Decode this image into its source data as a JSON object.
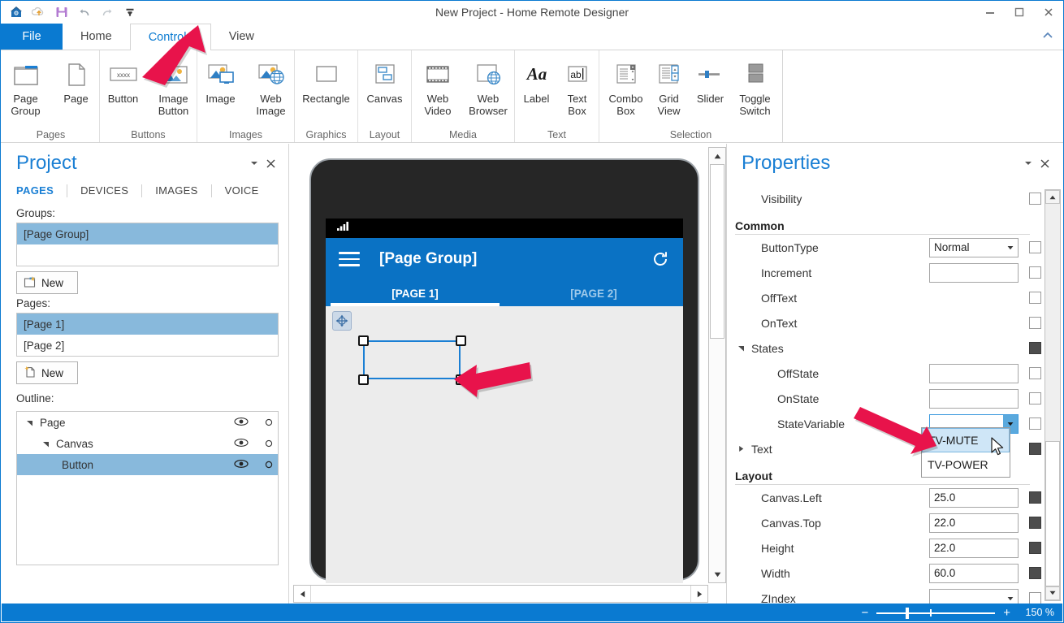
{
  "window": {
    "title": "New Project - Home Remote Designer",
    "quick_access": [
      "home-icon",
      "save-cloud-icon",
      "save-icon",
      "undo-icon",
      "redo-icon",
      "customize-qat-icon"
    ],
    "controls": {
      "minimize": "minimize-icon",
      "maximize": "maximize-icon",
      "close": "close-icon"
    }
  },
  "ribbon": {
    "tabs": [
      {
        "label": "File",
        "kind": "file"
      },
      {
        "label": "Home",
        "kind": "normal"
      },
      {
        "label": "Controls",
        "kind": "active"
      },
      {
        "label": "View",
        "kind": "normal"
      }
    ],
    "collapse_icon": "chevron-up-icon",
    "groups": [
      {
        "label": "Pages",
        "items": [
          {
            "label": "Page\nGroup",
            "icon": "page-group-icon"
          },
          {
            "label": "Page",
            "icon": "page-icon"
          }
        ]
      },
      {
        "label": "Buttons",
        "items": [
          {
            "label": "Button",
            "icon": "button-icon"
          },
          {
            "label": "Image\nButton",
            "icon": "image-button-icon"
          }
        ]
      },
      {
        "label": "Images",
        "items": [
          {
            "label": "Image",
            "icon": "image-icon"
          },
          {
            "label": "Web\nImage",
            "icon": "web-image-icon"
          }
        ]
      },
      {
        "label": "Graphics",
        "items": [
          {
            "label": "Rectangle",
            "icon": "rectangle-icon"
          }
        ]
      },
      {
        "label": "Layout",
        "items": [
          {
            "label": "Canvas",
            "icon": "canvas-icon"
          }
        ]
      },
      {
        "label": "Media",
        "items": [
          {
            "label": "Web\nVideo",
            "icon": "web-video-icon"
          },
          {
            "label": "Web\nBrowser",
            "icon": "web-browser-icon"
          }
        ]
      },
      {
        "label": "Text",
        "items": [
          {
            "label": "Label",
            "icon": "label-icon"
          },
          {
            "label": "Text\nBox",
            "icon": "text-box-icon"
          }
        ]
      },
      {
        "label": "Selection",
        "items": [
          {
            "label": "Combo\nBox",
            "icon": "combo-box-icon"
          },
          {
            "label": "Grid\nView",
            "icon": "grid-view-icon"
          },
          {
            "label": "Slider",
            "icon": "slider-icon"
          },
          {
            "label": "Toggle\nSwitch",
            "icon": "toggle-switch-icon"
          }
        ]
      }
    ]
  },
  "project_panel": {
    "title": "Project",
    "collapse_icon": "chevron-down-icon",
    "close_icon": "close-icon",
    "tabs": [
      {
        "label": "PAGES",
        "active": true
      },
      {
        "label": "DEVICES",
        "active": false
      },
      {
        "label": "IMAGES",
        "active": false
      },
      {
        "label": "VOICE",
        "active": false
      }
    ],
    "groups_label": "Groups:",
    "groups": [
      {
        "label": "[Page Group]",
        "selected": true
      },
      {
        "label": "",
        "selected": false
      }
    ],
    "groups_new_button": "New",
    "pages_label": "Pages:",
    "pages": [
      {
        "label": "[Page 1]",
        "selected": true
      },
      {
        "label": "[Page 2]",
        "selected": false
      }
    ],
    "pages_new_button": "New",
    "outline_label": "Outline:",
    "outline": [
      {
        "label": "Page",
        "depth": 0,
        "expanded": true,
        "selected": false,
        "visible_icon": "eye-icon",
        "lock_icon": "circle-icon"
      },
      {
        "label": "Canvas",
        "depth": 1,
        "expanded": true,
        "selected": false,
        "visible_icon": "eye-icon",
        "lock_icon": "circle-icon"
      },
      {
        "label": "Button",
        "depth": 2,
        "expanded": false,
        "selected": true,
        "visible_icon": "eye-icon",
        "lock_icon": "circle-icon"
      }
    ]
  },
  "designer": {
    "device_status_icon": "signal-bars-icon",
    "app_title": "[Page Group]",
    "menu_icon": "hamburger-icon",
    "refresh_icon": "refresh-icon",
    "tabs": [
      {
        "label": "[PAGE 1]",
        "active": true
      },
      {
        "label": "[PAGE 2]",
        "active": false
      }
    ],
    "move_handle_icon": "move-handle-icon",
    "h_scroll_left_icon": "triangle-left-icon",
    "h_scroll_right_icon": "triangle-right-icon",
    "v_scroll_up_icon": "triangle-up-icon",
    "v_scroll_down_icon": "triangle-down-icon"
  },
  "properties": {
    "title": "Properties",
    "collapse_icon": "chevron-down-icon",
    "close_icon": "close-icon",
    "rows": [
      {
        "type": "prop",
        "name": "Visibility",
        "indent": 1,
        "field": null,
        "check": "empty"
      },
      {
        "type": "section",
        "name": "Common"
      },
      {
        "type": "prop",
        "name": "ButtonType",
        "indent": 1,
        "field": {
          "kind": "combo",
          "value": "Normal"
        },
        "check": "empty"
      },
      {
        "type": "prop",
        "name": "Increment",
        "indent": 1,
        "field": {
          "kind": "text",
          "value": ""
        },
        "check": "empty"
      },
      {
        "type": "prop",
        "name": "OffText",
        "indent": 1,
        "field": null,
        "check": "empty"
      },
      {
        "type": "prop",
        "name": "OnText",
        "indent": 1,
        "field": null,
        "check": "empty"
      },
      {
        "type": "prop",
        "name": "States",
        "indent": 1,
        "expander": "down",
        "field": null,
        "check": "filled"
      },
      {
        "type": "prop",
        "name": "OffState",
        "indent": 2,
        "field": {
          "kind": "text",
          "value": ""
        },
        "check": "empty"
      },
      {
        "type": "prop",
        "name": "OnState",
        "indent": 2,
        "field": {
          "kind": "text",
          "value": ""
        },
        "check": "empty"
      },
      {
        "type": "prop",
        "name": "StateVariable",
        "indent": 2,
        "field": {
          "kind": "combo-open",
          "value": ""
        },
        "check": "empty"
      },
      {
        "type": "prop",
        "name": "Text",
        "indent": 1,
        "expander": "right",
        "field": null,
        "check": "filled"
      },
      {
        "type": "section",
        "name": "Layout"
      },
      {
        "type": "prop",
        "name": "Canvas.Left",
        "indent": 1,
        "field": {
          "kind": "text",
          "value": "25.0"
        },
        "check": "filled"
      },
      {
        "type": "prop",
        "name": "Canvas.Top",
        "indent": 1,
        "field": {
          "kind": "text",
          "value": "22.0"
        },
        "check": "filled"
      },
      {
        "type": "prop",
        "name": "Height",
        "indent": 1,
        "field": {
          "kind": "text",
          "value": "22.0"
        },
        "check": "filled"
      },
      {
        "type": "prop",
        "name": "Width",
        "indent": 1,
        "field": {
          "kind": "text",
          "value": "60.0"
        },
        "check": "filled"
      },
      {
        "type": "prop",
        "name": "ZIndex",
        "indent": 1,
        "field": {
          "kind": "combo",
          "value": ""
        },
        "check": "empty"
      }
    ],
    "state_variable_dropdown": {
      "open": true,
      "options": [
        {
          "label": "TV-MUTE",
          "highlighted": true
        },
        {
          "label": "TV-POWER",
          "highlighted": false
        }
      ]
    },
    "scroll_up_icon": "triangle-up-icon",
    "scroll_down_icon": "triangle-down-icon"
  },
  "statusbar": {
    "zoom_minus": "−",
    "zoom_plus": "+",
    "zoom_label": "150 %"
  },
  "annotations": {
    "arrow_color": "#e8134b",
    "arrows": [
      "arrow-to-button-tool",
      "arrow-to-selected-button",
      "arrow-to-state-variable-dropdown"
    ]
  },
  "colors": {
    "accent": "#0a7ad1",
    "panel_title": "#1a7fd4",
    "selection_blue": "#88b9dc",
    "appbar_blue": "#0a72c4"
  }
}
